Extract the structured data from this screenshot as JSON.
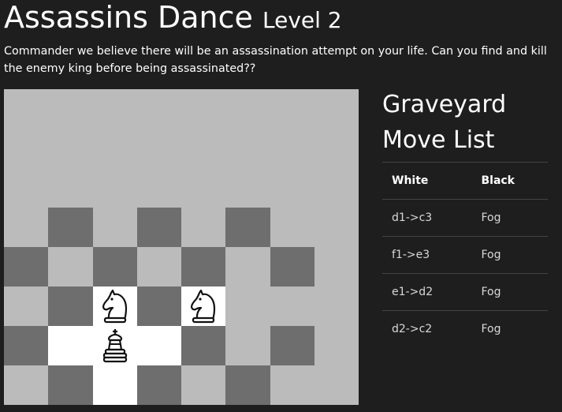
{
  "header": {
    "title": "Assassins Dance",
    "level": "Level 2",
    "description": "Commander we believe there will be an assassination attempt on your life. Can you find and kill the enemy king before being assassinated??"
  },
  "board": {
    "files": 8,
    "ranks": 8,
    "colors": {
      "fog": "#bbbbbb",
      "dark": "#6e6e6e",
      "light": "#ffffff"
    },
    "squares": [
      "ffffffff",
      "ffffffff",
      "ffffffff",
      "fdfdfdff",
      "dfdfdfdf",
      "fdwdwfff",
      "dwwwdfdf",
      "fdwdfdff"
    ],
    "pieces": [
      {
        "square": "c3",
        "piece": "knight",
        "color": "white",
        "icon": "white-knight-icon"
      },
      {
        "square": "e3",
        "piece": "knight",
        "color": "white",
        "icon": "white-knight-icon"
      },
      {
        "square": "c2",
        "piece": "king",
        "color": "white",
        "icon": "white-king-icon"
      }
    ]
  },
  "graveyard": {
    "heading": "Graveyard"
  },
  "move_list": {
    "heading": "Move List",
    "columns": [
      "White",
      "Black"
    ],
    "rows": [
      {
        "white": "d1->c3",
        "black": "Fog"
      },
      {
        "white": "f1->e3",
        "black": "Fog"
      },
      {
        "white": "e1->d2",
        "black": "Fog"
      },
      {
        "white": "d2->c2",
        "black": "Fog"
      }
    ]
  }
}
